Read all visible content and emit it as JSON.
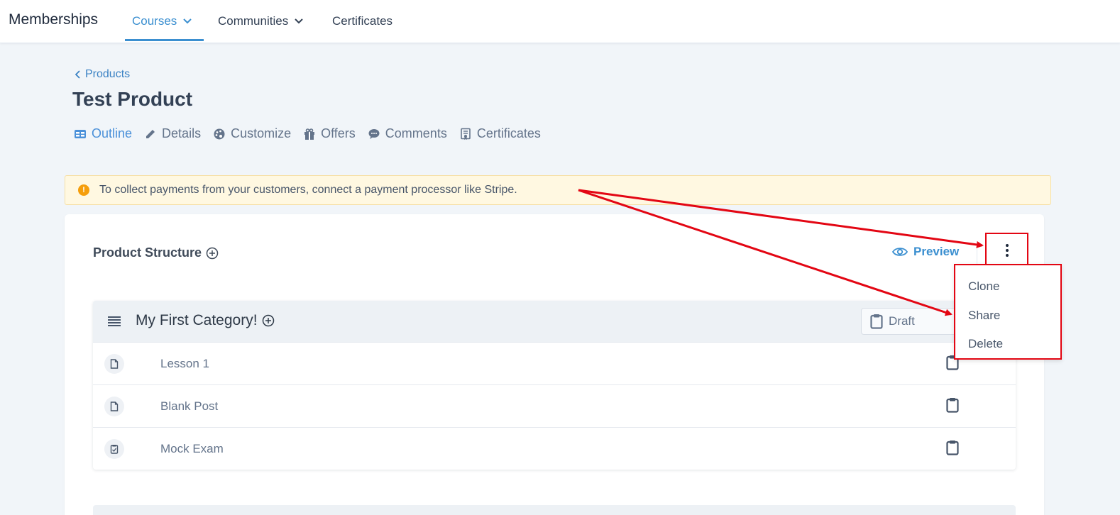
{
  "topbar": {
    "brand": "Memberships",
    "nav": [
      {
        "label": "Courses"
      },
      {
        "label": "Communities"
      },
      {
        "label": "Certificates"
      }
    ]
  },
  "breadcrumb": {
    "back_label": "Products"
  },
  "page": {
    "title": "Test Product"
  },
  "tabs": [
    {
      "label": "Outline",
      "icon": "table-icon"
    },
    {
      "label": "Details",
      "icon": "pencil-icon"
    },
    {
      "label": "Customize",
      "icon": "palette-icon"
    },
    {
      "label": "Offers",
      "icon": "gift-icon"
    },
    {
      "label": "Comments",
      "icon": "comment-icon"
    },
    {
      "label": "Certificates",
      "icon": "certificate-icon"
    }
  ],
  "alert": {
    "text": "To collect payments from your customers, connect a payment processor like Stripe."
  },
  "structure": {
    "title": "Product Structure",
    "preview_label": "Preview",
    "menu": [
      "Clone",
      "Share",
      "Delete"
    ]
  },
  "category": {
    "title": "My First Category!",
    "status_label": "Draft",
    "lessons": [
      {
        "label": "Lesson 1",
        "icon": "document-icon"
      },
      {
        "label": "Blank Post",
        "icon": "document-icon"
      },
      {
        "label": "Mock Exam",
        "icon": "quiz-icon"
      }
    ]
  },
  "colors": {
    "accent": "#3b8fd0",
    "warning": "#f59e0b",
    "annotation": "#e30613"
  }
}
